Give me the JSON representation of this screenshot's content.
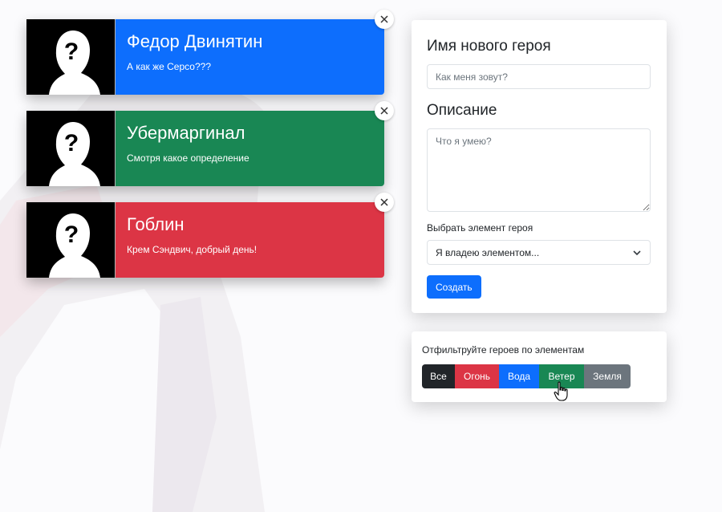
{
  "heroes": [
    {
      "name": "Федор Двинятин",
      "description": "А как же Серсо???",
      "color": "#0d6efd"
    },
    {
      "name": "Убермаргинал",
      "description": "Смотря какое определение",
      "color": "#198754"
    },
    {
      "name": "Гоблин",
      "description": "Крем Сэндвич, добрый день!",
      "color": "#dc3545"
    }
  ],
  "avatar_icon": "unknown-person-silhouette",
  "close_icon": "close-x",
  "form": {
    "name_label": "Имя нового героя",
    "name_placeholder": "Как меня зовут?",
    "name_value": "",
    "description_label": "Описание",
    "description_placeholder": "Что я умею?",
    "description_value": "",
    "element_label": "Выбрать элемент героя",
    "element_selected": "Я владею элементом...",
    "submit_label": "Создать",
    "submit_color": "#0d6efd"
  },
  "filter": {
    "label": "Отфильтруйте героев по элементам",
    "buttons": [
      {
        "label": "Все",
        "color": "#212529"
      },
      {
        "label": "Огонь",
        "color": "#dc3545"
      },
      {
        "label": "Вода",
        "color": "#0d6efd"
      },
      {
        "label": "Ветер",
        "color": "#198754"
      },
      {
        "label": "Земля",
        "color": "#6c757d"
      }
    ]
  },
  "cursor_icon": "hand-pointer"
}
